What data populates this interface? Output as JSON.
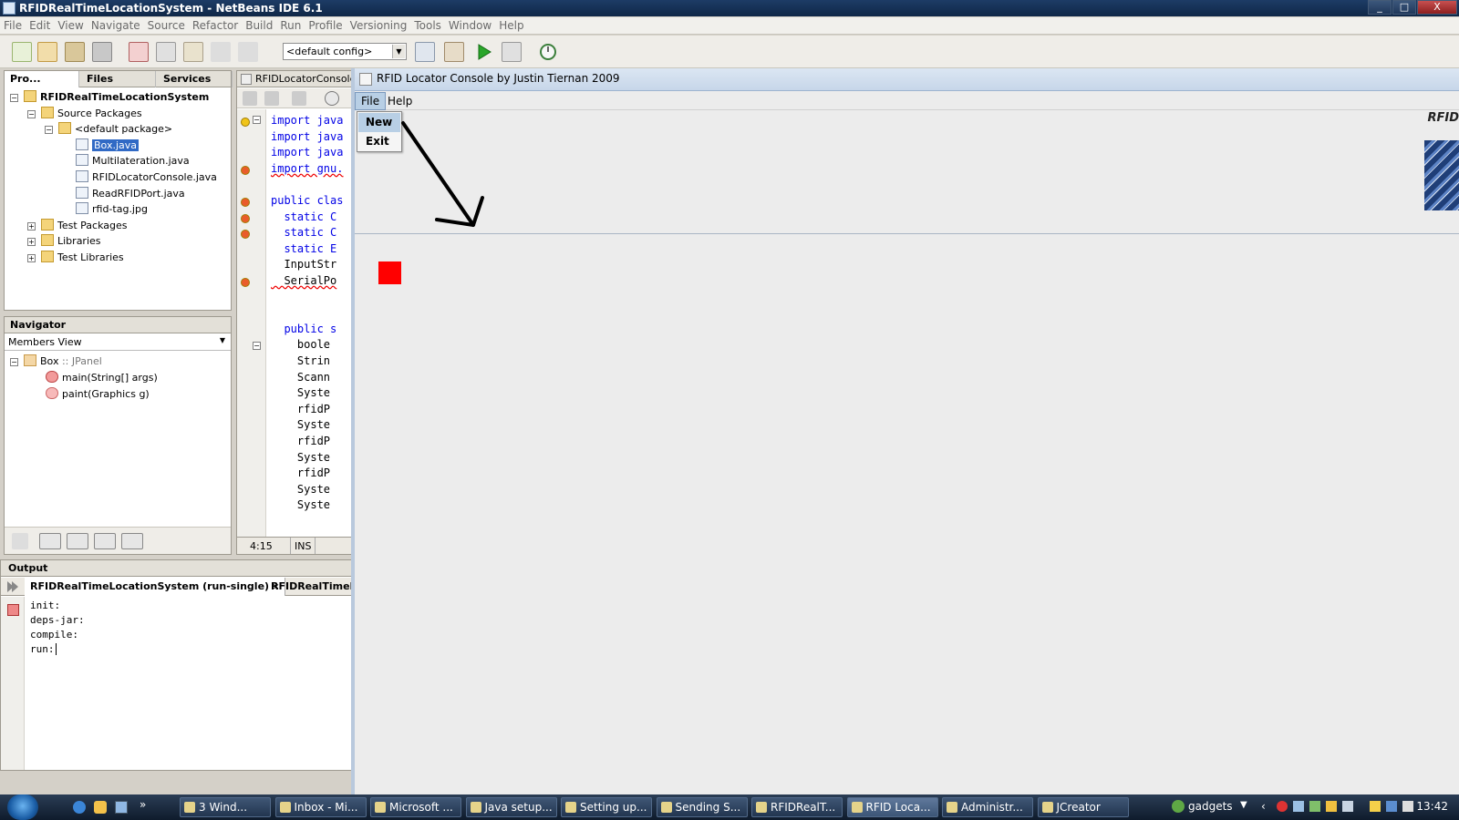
{
  "window": {
    "title": "RFIDRealTimeLocationSystem - NetBeans IDE 6.1",
    "controls": [
      "_",
      "□",
      "X"
    ]
  },
  "menubar": [
    "File",
    "Edit",
    "View",
    "Navigate",
    "Source",
    "Refactor",
    "Build",
    "Run",
    "Profile",
    "Versioning",
    "Tools",
    "Window",
    "Help"
  ],
  "toolbar": {
    "config": "<default config>"
  },
  "projects": {
    "tabs": [
      "Pro...",
      "Files",
      "Services"
    ],
    "tree": [
      {
        "label": "RFIDRealTimeLocationSystem",
        "depth": 0,
        "expanded": true,
        "bold": true
      },
      {
        "label": "Source Packages",
        "depth": 1,
        "expanded": true
      },
      {
        "label": "<default package>",
        "depth": 2,
        "expanded": true
      },
      {
        "label": "Box.java",
        "depth": 3,
        "selected": true
      },
      {
        "label": "Multilateration.java",
        "depth": 3
      },
      {
        "label": "RFIDLocatorConsole.java",
        "depth": 3
      },
      {
        "label": "ReadRFIDPort.java",
        "depth": 3
      },
      {
        "label": "rfid-tag.jpg",
        "depth": 3
      },
      {
        "label": "Test Packages",
        "depth": 1,
        "expanded": false
      },
      {
        "label": "Libraries",
        "depth": 1,
        "expanded": false
      },
      {
        "label": "Test Libraries",
        "depth": 1,
        "expanded": false
      }
    ]
  },
  "navigator": {
    "title": "Navigator",
    "view": "Members View",
    "class_name": "Box",
    "class_super": ":: JPanel",
    "members": [
      {
        "name": "main",
        "args": "(String[] args)"
      },
      {
        "name": "paint",
        "args": "(Graphics g)"
      }
    ]
  },
  "editor": {
    "tab": "RFIDLocatorConsole.j",
    "lines": [
      "import java",
      "import java",
      "import java",
      "import gnu.",
      "",
      "public clas",
      "  static C",
      "  static C",
      "  static E",
      "  InputStr",
      "  SerialPo",
      "",
      "",
      "  public s",
      "    boole",
      "    Strin",
      "    Scann",
      "    Syste",
      "    rfidP",
      "    Syste",
      "    rfidP",
      "    Syste",
      "    rfidP",
      "    Syste",
      "    Syste"
    ],
    "position": "4:15",
    "mode": "INS"
  },
  "output": {
    "title": "Output",
    "tabs": [
      "RFIDRealTimeLocationSystem (run-single)",
      "RFIDRealTimeL"
    ],
    "lines": [
      "init:",
      "deps-jar:",
      "compile:",
      "run:"
    ]
  },
  "rfid_window": {
    "title": "RFID Locator Console by Justin Tiernan 2009",
    "menu": [
      "File",
      "Help"
    ],
    "file_menu_items": [
      "New",
      "Exit"
    ],
    "logo_text": "RFID"
  },
  "taskbar": {
    "items": [
      "3 Wind...",
      "Inbox - Mi...",
      "Microsoft ...",
      "Java setup...",
      "Setting up...",
      "Sending S...",
      "RFIDRealT...",
      "RFID Loca...",
      "Administr...",
      "JCreator"
    ],
    "active_index": 7,
    "gadgets": "gadgets",
    "clock": "13:42"
  },
  "colors": {
    "accent_selection": "#316ac5",
    "red_square": "#ff0000"
  }
}
